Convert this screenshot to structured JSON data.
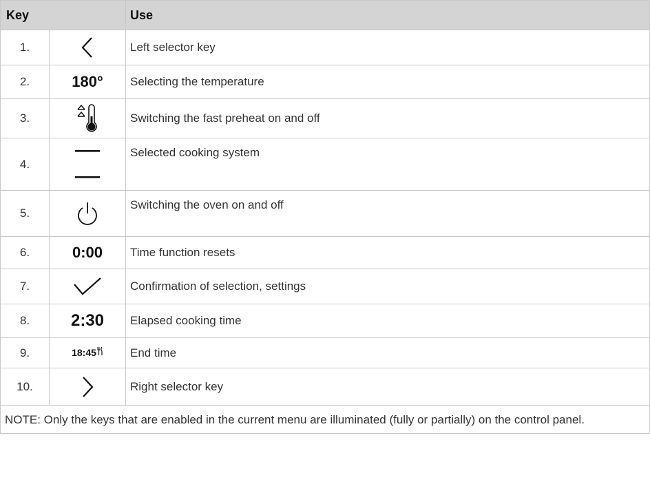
{
  "header": {
    "key": "Key",
    "use": "Use"
  },
  "rows": [
    {
      "num": "1.",
      "icon": "chevron-left-icon",
      "use": "Left selector key"
    },
    {
      "num": "2.",
      "symbol_text": "180°",
      "use": "Selecting the temperature"
    },
    {
      "num": "3.",
      "icon": "fast-preheat-thermometer-icon",
      "use": "Switching the fast preheat on and off"
    },
    {
      "num": "4.",
      "icon": "cooking-system-bars-icon",
      "use": "Selected cooking system"
    },
    {
      "num": "5.",
      "icon": "power-icon",
      "use": "Switching the oven on and off"
    },
    {
      "num": "6.",
      "symbol_text": "0:00",
      "use": "Time function resets"
    },
    {
      "num": "7.",
      "icon": "checkmark-icon",
      "use": "Confirmation of selection, settings"
    },
    {
      "num": "8.",
      "symbol_text": "2:30",
      "use": "Elapsed cooking time"
    },
    {
      "num": "9.",
      "symbol_text": "18:45",
      "icon": "cutlery-icon",
      "use": "End time"
    },
    {
      "num": "10.",
      "icon": "chevron-right-icon",
      "use": "Right selector key"
    }
  ],
  "note": "NOTE: Only the keys that are enabled in the current menu are illuminated (fully or partially) on the control panel."
}
